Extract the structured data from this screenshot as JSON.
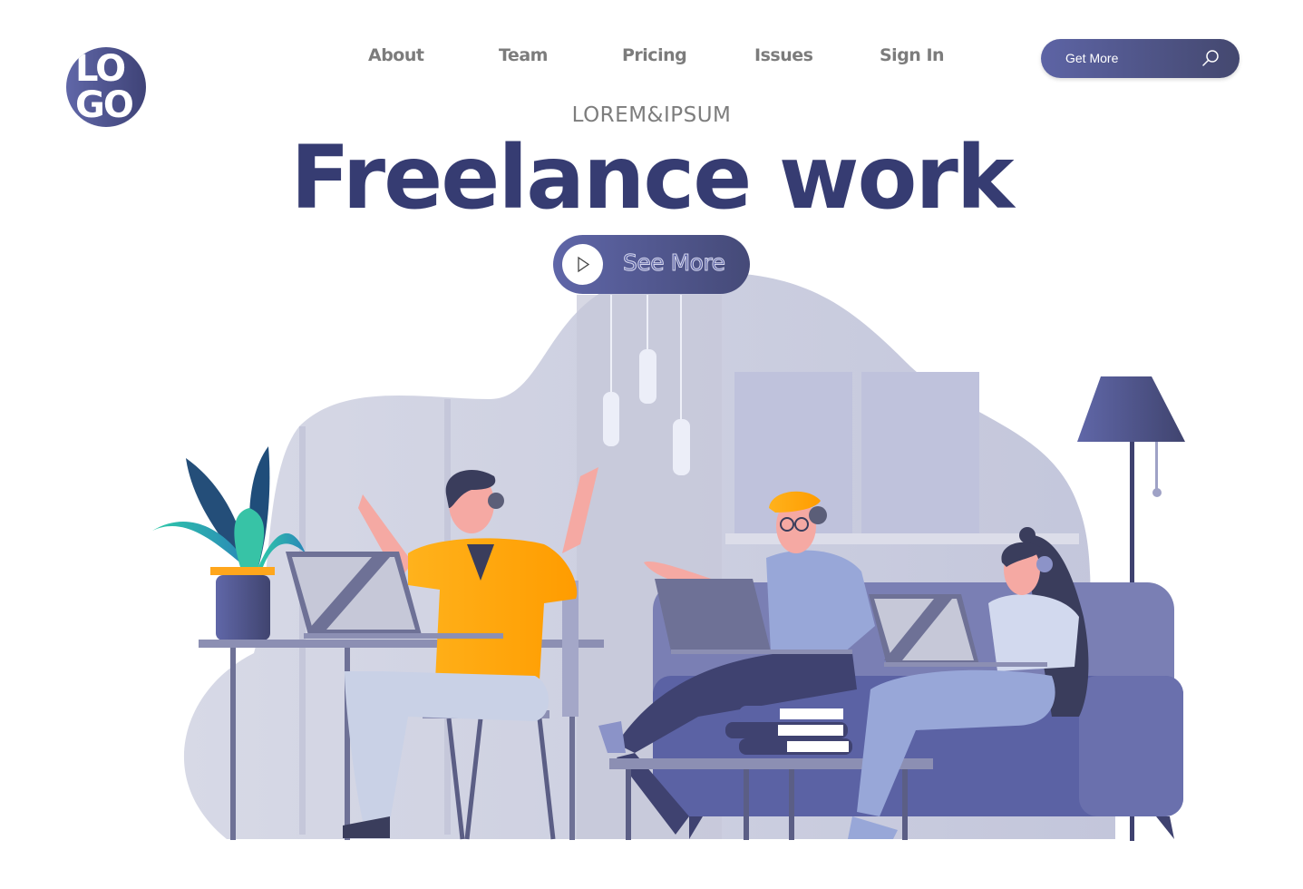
{
  "logo": {
    "line1": "LO",
    "line2": "GO"
  },
  "nav": {
    "items": [
      {
        "label": "About"
      },
      {
        "label": "Team"
      },
      {
        "label": "Pricing"
      },
      {
        "label": "Issues"
      },
      {
        "label": "Sign In"
      }
    ]
  },
  "header_button": {
    "label": "Get More",
    "icon": "search-icon"
  },
  "hero": {
    "subtitle": "LOREM&IPSUM",
    "title": "Freelance work",
    "cta_label": "See More",
    "cta_icon": "play-icon"
  },
  "colors": {
    "brand": "#363c72",
    "button_start": "#5f66a8",
    "button_end": "#454a78",
    "nav_text": "#7c7c7c",
    "shirt_orange": "#ffb21c",
    "plant_teal": "#2dc5b0"
  },
  "illustration": {
    "description": "Three freelancers with headsets working on laptops in a cozy office: one at a desk, two on a sofa",
    "people_count": 3
  }
}
